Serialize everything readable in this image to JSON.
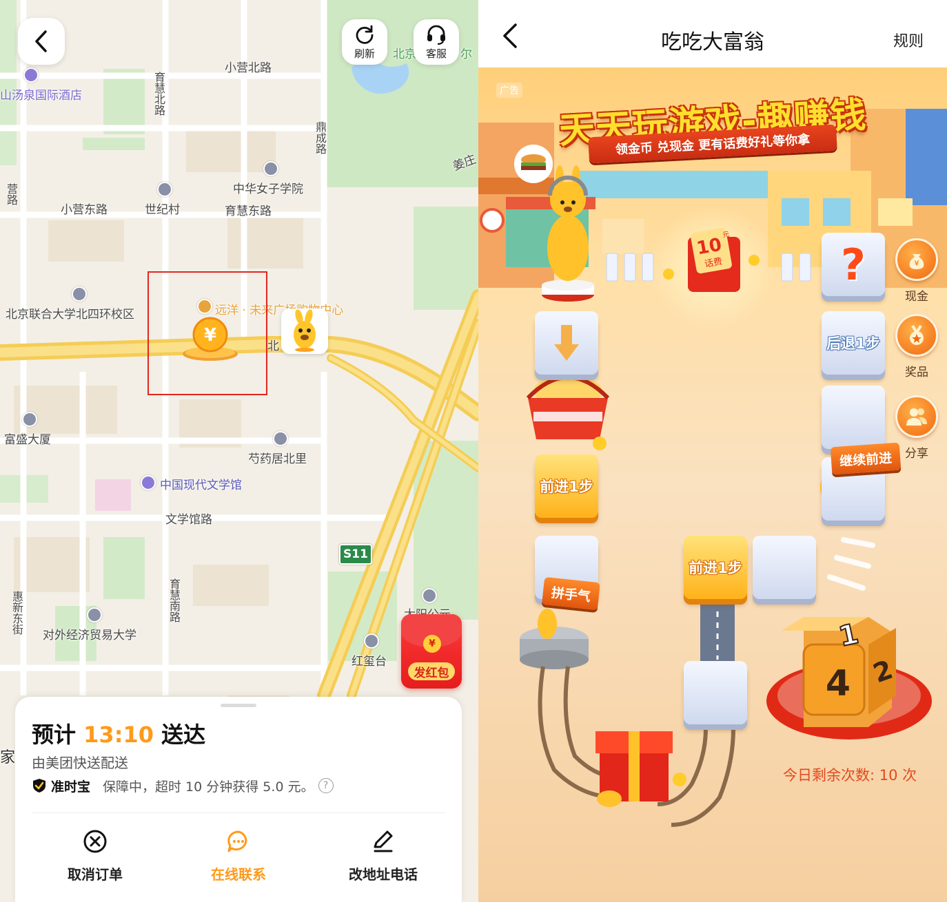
{
  "map_screen": {
    "toolbar": {
      "refresh_label": "刷新",
      "service_label": "客服"
    },
    "labels": {
      "xiaoying_north_rd": "小营北路",
      "yuhui_north_rd": "育慧北路",
      "hot_spring_hotel": "山汤泉国际酒店",
      "dingcheng_rd": "鼎成路",
      "jiangzhuang": "姜庄",
      "zhonghua_womens": "中华女子学院",
      "xiaoying_east_rd": "小营东路",
      "shijicun": "世纪村",
      "yuhui_east_rd": "育慧东路",
      "lianhe_univ": "北京联合大学北四环校区",
      "yuanyang_mall": "远洋 · 未来广场购物中心",
      "beijing_partial": "北京",
      "north_partial": "北",
      "yuer_partial": "尔",
      "fusheng": "富盛大厦",
      "shaoyaoju": "芍药居北里",
      "literature_museum": "中国现代文学馆",
      "wenxueguan_rd": "文学馆路",
      "s11": "S11",
      "yuhui_south_rd": "育慧南路",
      "huixin_east_st": "惠新东街",
      "uibe": "对外经济贸易大学",
      "hongxitai": "红玺台",
      "taiyang_partial": "太阳公元",
      "yingyin_partial": "营路",
      "jia_partial": "家"
    },
    "red_packet": {
      "symbol": "¥",
      "label": "发红包"
    },
    "coin_symbol": "¥",
    "order": {
      "eta_prefix": "预计",
      "eta_time": "13:10",
      "eta_suffix": "送达",
      "carrier": "由美团快送配送",
      "guarantee_brand": "准时宝",
      "guarantee_desc": "保障中，超时 10 分钟获得 5.0 元。",
      "help_icon": "?"
    },
    "actions": {
      "cancel": "取消订单",
      "chat": "在线联系",
      "edit": "改地址电话"
    }
  },
  "game_screen": {
    "title": "吃吃大富翁",
    "rules": "规则",
    "ad_tag": "广告",
    "banner_title": "天天玩游戏-趣赚钱",
    "banner_subtitle": "领金币 兑现金 更有话费好礼等你拿",
    "prize_card": {
      "amount": "10",
      "unit": "元",
      "label": "话费"
    },
    "tiles": {
      "question": "?",
      "back_step": "后退1步",
      "forward_left": "前进1步",
      "forward_mid": "前进1步"
    },
    "signs": {
      "continue": "继续前进",
      "luck": "拼手气"
    },
    "side": {
      "cash": "现金",
      "prize": "奖品",
      "share": "分享"
    },
    "dice": {
      "top": "1",
      "front": "4",
      "side": "2"
    },
    "remaining": "今日剩余次数: 10 次"
  },
  "colors": {
    "accent_orange": "#ff9a1a",
    "red": "#e0261f",
    "game_text_red": "#e2491f"
  }
}
